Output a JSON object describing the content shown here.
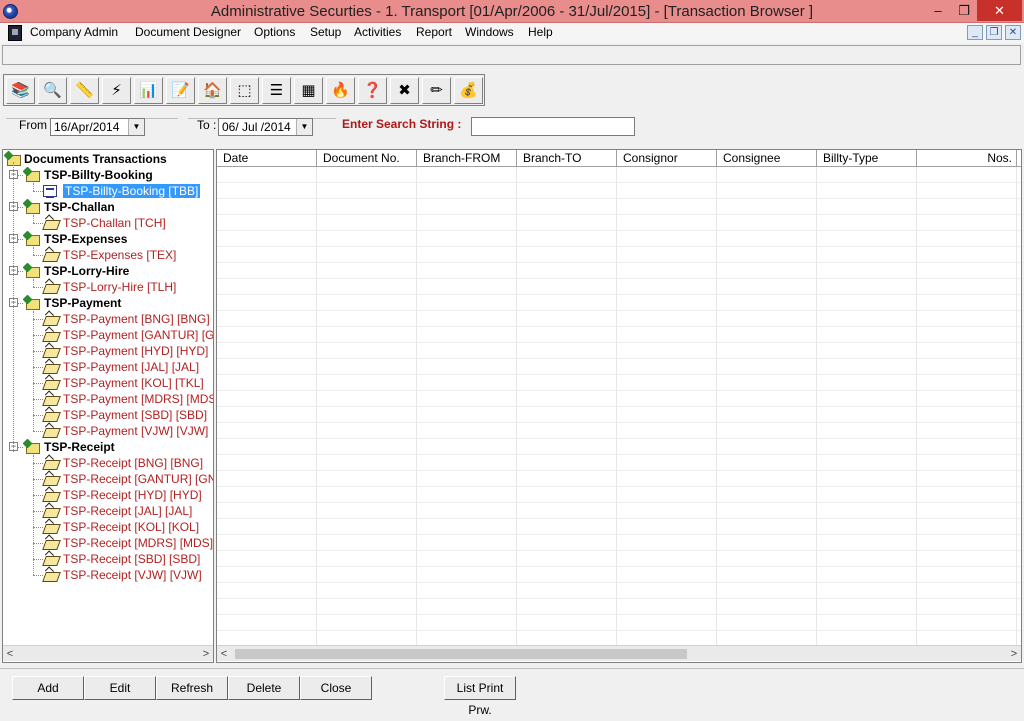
{
  "window": {
    "title": "Administrative Securties - 1. Transport   [01/Apr/2006 - 31/Jul/2015] - [Transaction Browser ]",
    "minimize_glyph": "–",
    "restore_glyph": "❐",
    "close_glyph": "✕"
  },
  "menu": [
    "Company Admin",
    "Document Designer",
    "Options",
    "Setup",
    "Activities",
    "Report",
    "Windows",
    "Help"
  ],
  "mdi_controls": [
    "_",
    "❐",
    "✕"
  ],
  "toolbar": {
    "buttons": [
      {
        "name": "books-icon",
        "glyph": "📚"
      },
      {
        "name": "preview-icon",
        "glyph": "🔍"
      },
      {
        "name": "ruler-icon",
        "glyph": "📏"
      },
      {
        "name": "lightning-icon",
        "glyph": "⚡"
      },
      {
        "name": "bar-chart-icon",
        "glyph": "📊"
      },
      {
        "name": "memo-icon",
        "glyph": "📝"
      },
      {
        "name": "house-user-icon",
        "glyph": "🏠"
      },
      {
        "name": "frame-icon",
        "glyph": "⬚"
      },
      {
        "name": "lines-icon",
        "glyph": "☰"
      },
      {
        "name": "calendar-grid-icon",
        "glyph": "▦"
      },
      {
        "name": "fire-icon",
        "glyph": "🔥"
      },
      {
        "name": "help-question-icon",
        "glyph": "❓"
      },
      {
        "name": "close-x-icon",
        "glyph": "✖"
      },
      {
        "name": "edit-pencil-icon",
        "glyph": "✏"
      },
      {
        "name": "cashbox-icon",
        "glyph": "💰"
      }
    ]
  },
  "filter": {
    "from_label": "From :",
    "from_value": "16/Apr/2014",
    "to_label": "To :",
    "to_value": "06/ Jul /2014",
    "search_label": "Enter Search String :",
    "search_value": ""
  },
  "tree": {
    "root": "Documents Transactions",
    "groups": [
      {
        "label": "TSP-Billty-Booking",
        "items": [
          "TSP-Billty-Booking [TBB]"
        ]
      },
      {
        "label": "TSP-Challan",
        "items": [
          "TSP-Challan [TCH]"
        ]
      },
      {
        "label": "TSP-Expenses",
        "items": [
          "TSP-Expenses [TEX]"
        ]
      },
      {
        "label": "TSP-Lorry-Hire",
        "items": [
          "TSP-Lorry-Hire [TLH]"
        ]
      },
      {
        "label": "TSP-Payment",
        "items": [
          "TSP-Payment [BNG] [BNG]",
          "TSP-Payment [GANTUR] [GNT]",
          "TSP-Payment [HYD] [HYD]",
          "TSP-Payment [JAL] [JAL]",
          "TSP-Payment [KOL] [TKL]",
          "TSP-Payment [MDRS] [MDS]",
          "TSP-Payment [SBD] [SBD]",
          "TSP-Payment [VJW] [VJW]"
        ]
      },
      {
        "label": "TSP-Receipt",
        "items": [
          "TSP-Receipt [BNG] [BNG]",
          "TSP-Receipt [GANTUR] [GNT]",
          "TSP-Receipt [HYD] [HYD]",
          "TSP-Receipt [JAL] [JAL]",
          "TSP-Receipt [KOL] [KOL]",
          "TSP-Receipt [MDRS] [MDS]",
          "TSP-Receipt [SBD] [SBD]",
          "TSP-Receipt [VJW] [VJW]"
        ]
      }
    ],
    "selected": "TSP-Billty-Booking [TBB]"
  },
  "grid": {
    "columns": [
      "Date",
      "Document No.",
      "Branch-FROM",
      "Branch-TO",
      "Consignor",
      "Consignee",
      "Billty-Type",
      "Nos."
    ]
  },
  "buttons": {
    "add": "Add",
    "edit": "Edit",
    "refresh": "Refresh",
    "delete": "Delete",
    "close": "Close",
    "list_print": "List Print Prw."
  },
  "scroll": {
    "left": "<",
    "right": ">"
  }
}
